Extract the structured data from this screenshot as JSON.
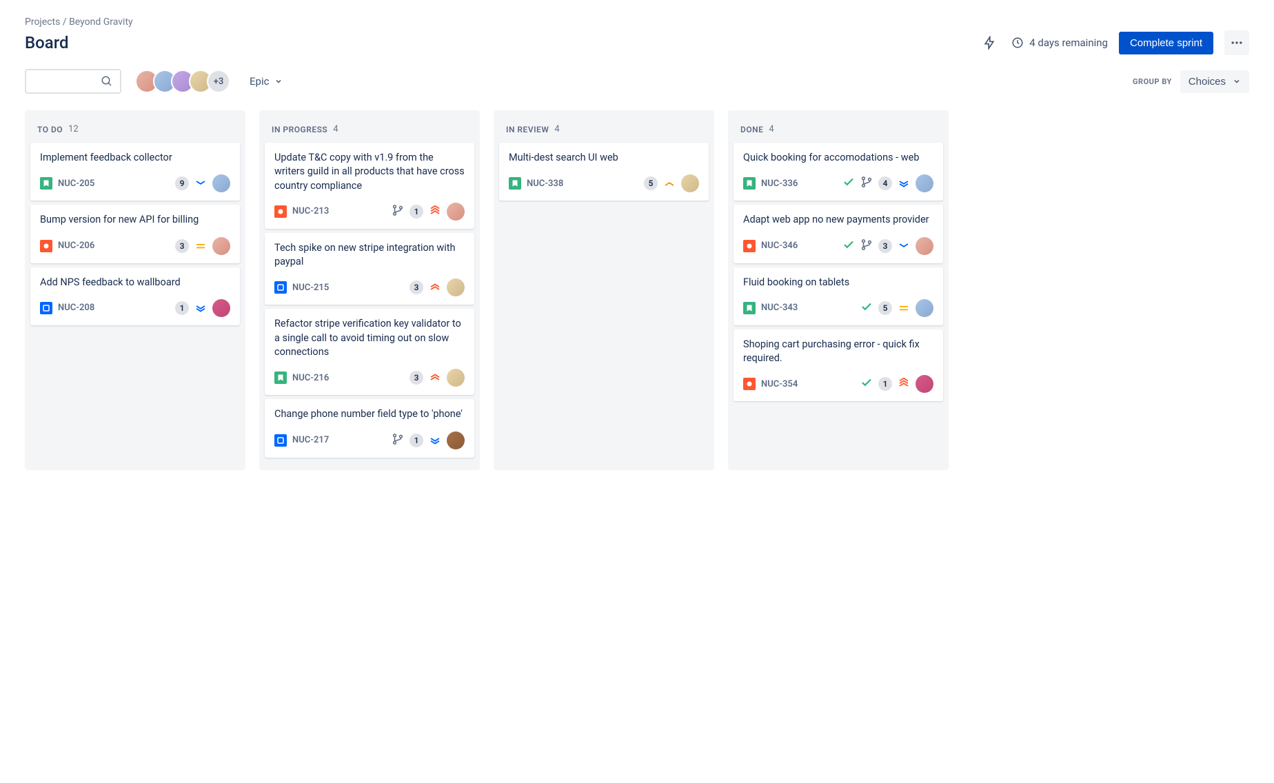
{
  "breadcrumb": {
    "root": "Projects",
    "project": "Beyond Gravity"
  },
  "page_title": "Board",
  "header": {
    "remaining": "4 days remaining",
    "complete_label": "Complete sprint"
  },
  "toolbar": {
    "avatar_overflow": "+3",
    "epic_label": "Epic",
    "groupby_label": "GROUP BY",
    "choices_label": "Choices"
  },
  "columns": [
    {
      "title": "TO DO",
      "count": "12",
      "cards": [
        {
          "title": "Implement feedback collector",
          "type": "story",
          "key": "NUC-205",
          "badge": "9",
          "priority": "low",
          "avatar": "av2"
        },
        {
          "title": "Bump version for new API for billing",
          "type": "bug",
          "key": "NUC-206",
          "badge": "3",
          "priority": "medium",
          "avatar": "av1"
        },
        {
          "title": "Add NPS feedback to wallboard",
          "type": "task",
          "key": "NUC-208",
          "badge": "1",
          "priority": "lowest",
          "avatar": "av5"
        }
      ]
    },
    {
      "title": "IN PROGRESS",
      "count": "4",
      "cards": [
        {
          "title": "Update T&C copy with v1.9 from the writers guild in all products that have cross country compliance",
          "type": "bug",
          "key": "NUC-213",
          "branch": true,
          "badge": "1",
          "priority": "highest",
          "avatar": "av1"
        },
        {
          "title": "Tech spike on new stripe integration with paypal",
          "type": "task",
          "key": "NUC-215",
          "badge": "3",
          "priority": "high",
          "avatar": "av4"
        },
        {
          "title": "Refactor stripe verification key validator to a single call to avoid timing out on slow connections",
          "type": "story",
          "key": "NUC-216",
          "badge": "3",
          "priority": "high",
          "avatar": "av4"
        },
        {
          "title": "Change phone number field type to 'phone'",
          "type": "task",
          "key": "NUC-217",
          "branch": true,
          "badge": "1",
          "priority": "lowest",
          "avatar": "av6"
        }
      ]
    },
    {
      "title": "IN REVIEW",
      "count": "4",
      "cards": [
        {
          "title": "Multi-dest search UI web",
          "type": "story",
          "key": "NUC-338",
          "badge": "5",
          "priority": "medium-up",
          "avatar": "av4"
        }
      ]
    },
    {
      "title": "DONE",
      "count": "4",
      "cards": [
        {
          "title": "Quick booking for accomodations - web",
          "type": "story",
          "key": "NUC-336",
          "done": true,
          "branch": true,
          "badge": "4",
          "priority": "lowest",
          "avatar": "av2"
        },
        {
          "title": "Adapt web app no new payments provider",
          "type": "bug",
          "key": "NUC-346",
          "done": true,
          "branch": true,
          "badge": "3",
          "priority": "low",
          "avatar": "av1"
        },
        {
          "title": "Fluid booking on tablets",
          "type": "story",
          "key": "NUC-343",
          "done": true,
          "badge": "5",
          "priority": "medium",
          "avatar": "av2"
        },
        {
          "title": "Shoping cart purchasing error - quick fix required.",
          "type": "bug",
          "key": "NUC-354",
          "done": true,
          "badge": "1",
          "priority": "highest",
          "avatar": "av5"
        }
      ]
    }
  ]
}
